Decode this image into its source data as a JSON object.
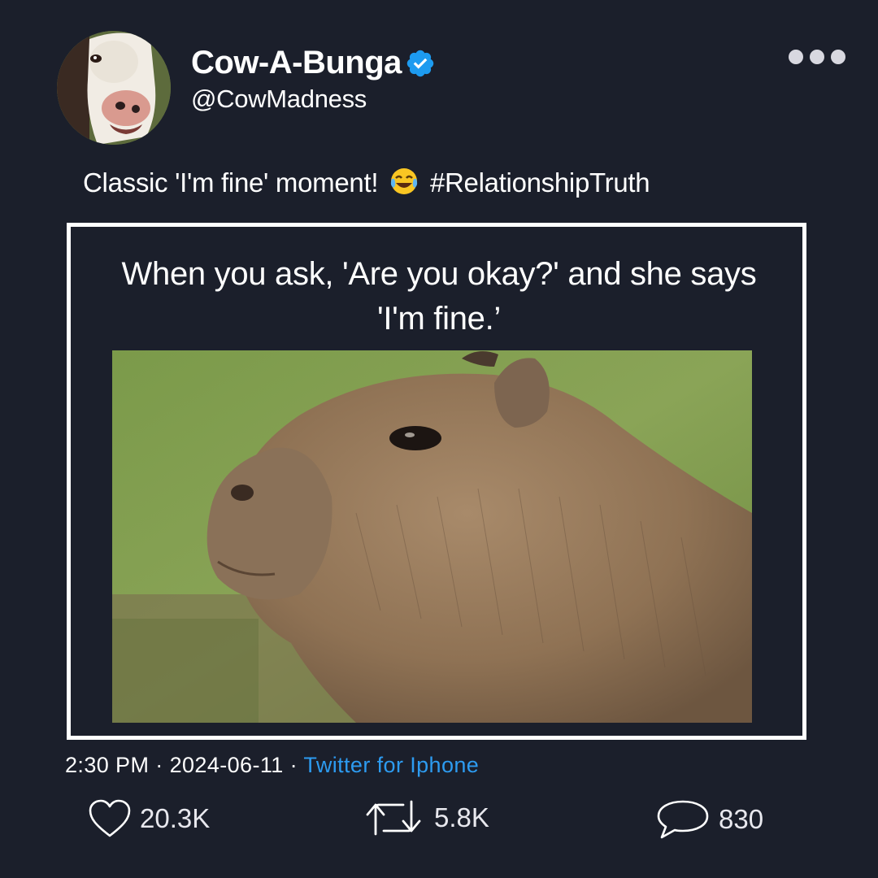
{
  "header": {
    "display_name": "Cow-A-Bunga",
    "handle": "@CowMadness",
    "verified": true
  },
  "tweet": {
    "text_before_emoji": "Classic 'I'm fine' moment!",
    "emoji": "😂",
    "text_after_emoji": "#RelationshipTruth"
  },
  "media": {
    "caption_line1": "When you ask, 'Are you okay?' and she says",
    "caption_line2": "'I'm fine.’"
  },
  "meta": {
    "time": "2:30 PM",
    "date": "2024-06-11",
    "separator": "·",
    "source": "Twitter for Iphone"
  },
  "actions": {
    "likes": "20.3K",
    "retweets": "5.8K",
    "replies": "830"
  },
  "colors": {
    "background": "#1b1f2b",
    "verified": "#1d9bf0",
    "link": "#2d9bf0"
  }
}
